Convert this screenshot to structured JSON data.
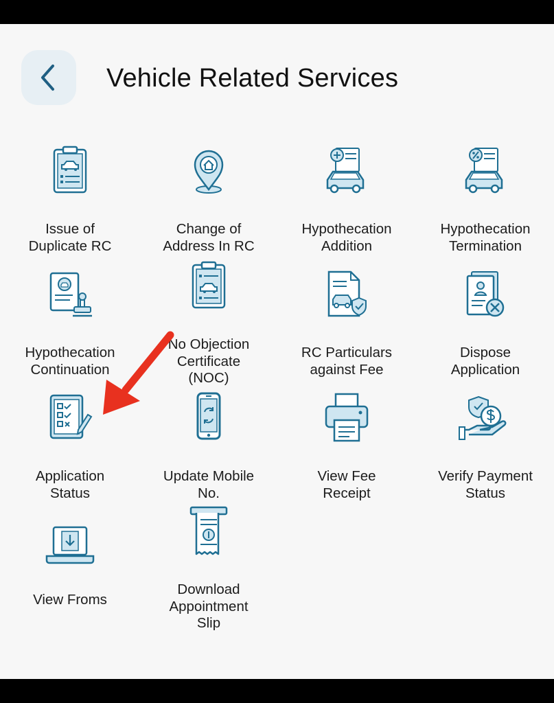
{
  "header": {
    "back_icon": "chevron-left-icon",
    "title": "Vehicle Related Services"
  },
  "colors": {
    "icon_stroke": "#1f6f93",
    "icon_fill": "#cfe6f1",
    "back_bg": "#e7eff4",
    "arrow": "#e8311f"
  },
  "services": [
    {
      "label": "Issue of\nDuplicate RC",
      "icon": "clipboard-car-icon"
    },
    {
      "label": "Change of\nAddress In RC",
      "icon": "location-pin-home-icon"
    },
    {
      "label": "Hypothecation\nAddition",
      "icon": "car-document-plus-icon"
    },
    {
      "label": "Hypothecation\nTermination",
      "icon": "car-document-percent-icon"
    },
    {
      "label": "Hypothecation\nContinuation",
      "icon": "document-stamp-icon"
    },
    {
      "label": "No Objection\nCertificate\n(NOC)",
      "icon": "clipboard-car-noc-icon"
    },
    {
      "label": "RC Particulars\nagainst Fee",
      "icon": "document-car-shield-icon"
    },
    {
      "label": "Dispose\nApplication",
      "icon": "document-cancel-icon"
    },
    {
      "label": "Application\nStatus",
      "icon": "checklist-pencil-icon"
    },
    {
      "label": "Update Mobile\nNo.",
      "icon": "mobile-phone-refresh-icon"
    },
    {
      "label": "View Fee\nReceipt",
      "icon": "printer-receipt-icon"
    },
    {
      "label": "Verify Payment\nStatus",
      "icon": "hand-money-shield-icon"
    },
    {
      "label": "View Froms",
      "icon": "laptop-download-icon"
    },
    {
      "label": "Download\nAppointment\nSlip",
      "icon": "receipt-slip-icon"
    }
  ],
  "annotation": {
    "pointer": "red-arrow-icon",
    "points_to": "Application Status"
  }
}
